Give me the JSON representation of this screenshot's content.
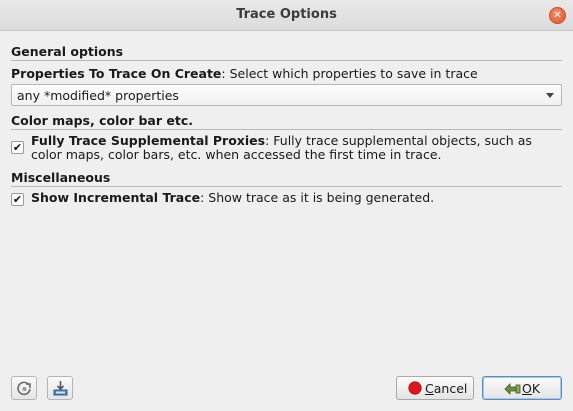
{
  "window": {
    "title": "Trace Options",
    "close_glyph": "✕"
  },
  "general": {
    "header": "General options",
    "properties_label": "Properties To Trace On Create",
    "properties_desc": ": Select which properties to save in trace",
    "properties_value": "any *modified* properties"
  },
  "colormaps": {
    "header": "Color maps, color bar etc.",
    "checked": true,
    "check_glyph": "✔",
    "label": "Fully Trace Supplemental Proxies",
    "desc": ": Fully trace supplemental objects, such as color maps, color bars, etc. when accessed the first time in trace."
  },
  "misc": {
    "header": "Miscellaneous",
    "checked": true,
    "check_glyph": "✔",
    "label": "Show Incremental Trace",
    "desc": ": Show trace as it is being generated."
  },
  "footer": {
    "restore_icon": "restore-defaults-icon",
    "save_icon": "save-as-default-icon",
    "cancel_first": "C",
    "cancel_rest": "ancel",
    "ok_first": "O",
    "ok_rest": "K"
  },
  "colors": {
    "cancel_icon": "#e0141e",
    "ok_icon": "#6b8f3a",
    "close_button": "#e0562c"
  }
}
